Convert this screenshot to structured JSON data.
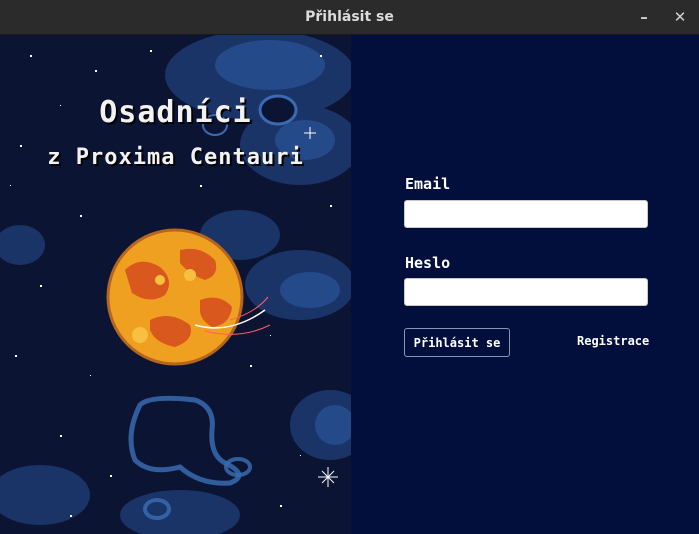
{
  "window": {
    "title": "Přihlásit se",
    "minimize_glyph": "–",
    "close_glyph": "✕"
  },
  "game": {
    "title_line1": "Osadníci",
    "title_line2": "z Proxima Centauri"
  },
  "form": {
    "email_label": "Email",
    "email_value": "",
    "password_label": "Heslo",
    "password_value": "",
    "login_button": "Přihlásit se",
    "register_link": "Registrace"
  },
  "colors": {
    "panel_background": "#020f3c",
    "art_background": "#0c1434",
    "planet_primary": "#f0a020",
    "planet_accent": "#d2461e"
  },
  "icons": {
    "minimize": "minimize-icon",
    "close": "close-icon",
    "planet": "planet-illustration"
  }
}
